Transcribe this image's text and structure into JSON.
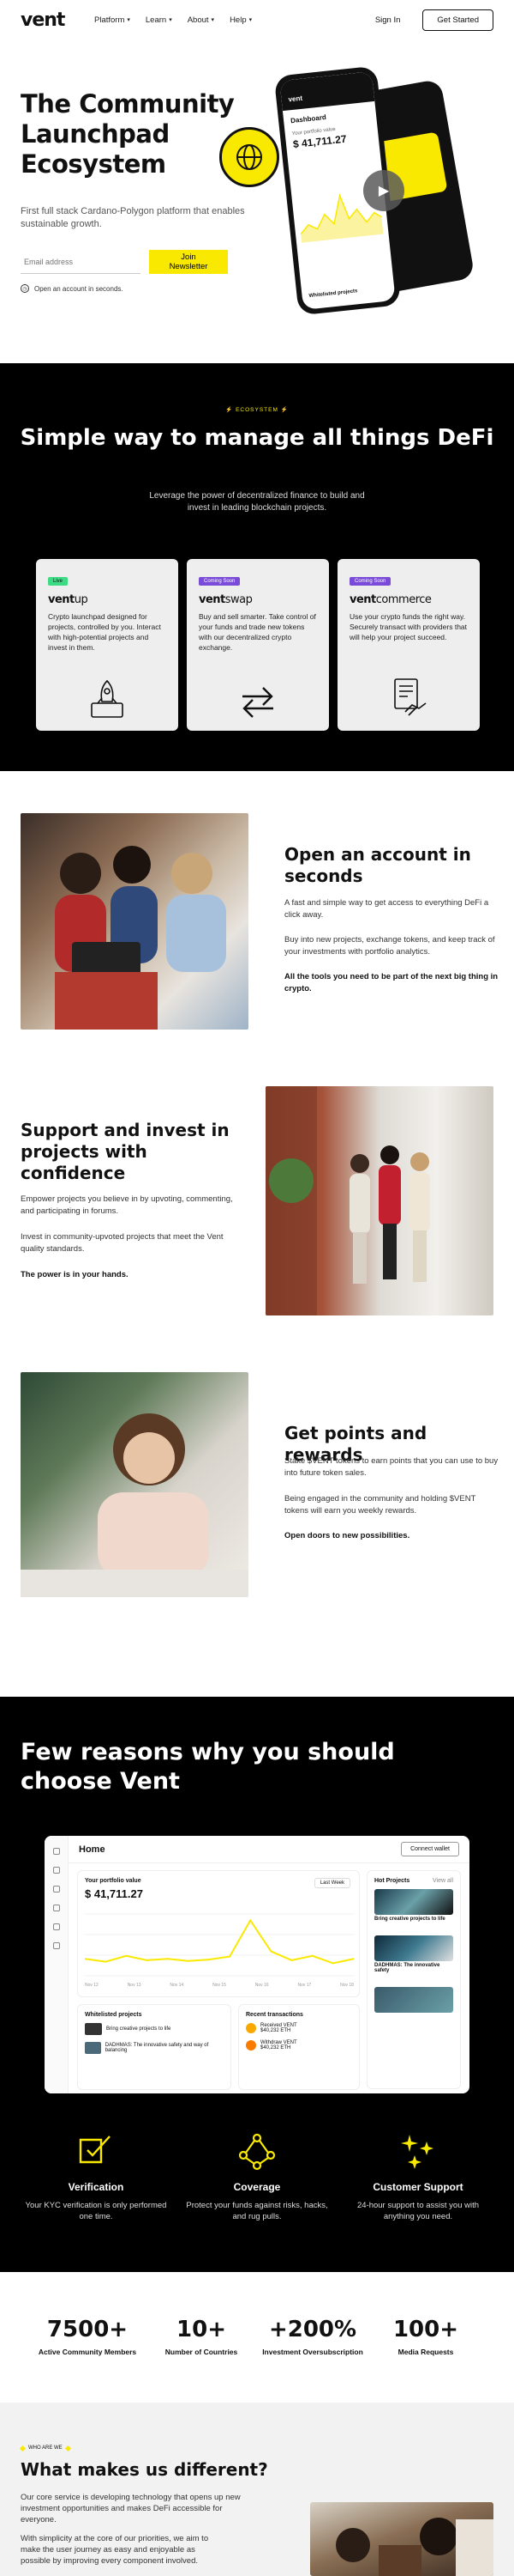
{
  "nav": {
    "logo": "vent",
    "links": [
      {
        "label": "Platform"
      },
      {
        "label": "Learn"
      },
      {
        "label": "About"
      },
      {
        "label": "Help"
      }
    ],
    "signin": "Sign In",
    "cta": "Get Started"
  },
  "hero": {
    "title": "The Community Launchpad Ecosystem",
    "subtitle": "First full stack Cardano-Polygon platform that enables sustainable growth.",
    "email_placeholder": "Email address",
    "button": "Join Newsletter",
    "note": "Open an account in seconds.",
    "phone": {
      "brand": "vent",
      "dashboard": "Dashboard",
      "portfolio_label": "Your portfolio value",
      "portfolio_value": "$ 41,711.27",
      "footer": "Whitelisted projects"
    }
  },
  "ecosystem": {
    "tag": "ECOSYSTEM",
    "title": "Simple way to manage all things DeFi",
    "subtitle": "Leverage the power of decentralized finance to build and invest in leading blockchain projects.",
    "cards": [
      {
        "badge": "Live",
        "brand_bold": "vent",
        "brand_light": "up",
        "desc": "Crypto launchpad designed for projects, controlled by you. Interact with high-potential projects and invest in them.",
        "icon": "rocket-icon"
      },
      {
        "badge": "Coming Soon",
        "brand_bold": "vent",
        "brand_light": "swap",
        "desc": "Buy and sell smarter. Take control of your funds and trade new tokens with our decentralized crypto exchange.",
        "icon": "swap-arrows-icon"
      },
      {
        "badge": "Coming Soon",
        "brand_bold": "vent",
        "brand_light": "commerce",
        "desc": "Use your crypto funds the right way. Securely transact with providers that will help your project succeed.",
        "icon": "contract-handshake-icon"
      }
    ]
  },
  "features": [
    {
      "title": "Open an account in seconds",
      "p1": "A fast and simple way to get access to everything DeFi a click away.",
      "p2": "Buy into new projects, exchange tokens, and keep track of your investments with portfolio analytics.",
      "bold": "All the tools you need to be part of the next big thing in crypto."
    },
    {
      "title": "Support and invest in projects with confidence",
      "p1": "Empower projects you believe in by upvoting, commenting, and participating in forums.",
      "p2": "Invest in community-upvoted projects that meet the Vent quality standards.",
      "bold": "The power is in your hands."
    },
    {
      "title": "Get points and rewards",
      "p1": "Stake $VENT tokens to earn points that you can use to buy into future token sales.",
      "p2": "Being engaged in the community and holding $VENT tokens will earn you weekly rewards.",
      "bold": "Open doors to new possibilities."
    }
  ],
  "reasons": {
    "title": "Few reasons why you should choose Vent",
    "dashboard": {
      "home": "Home",
      "connect": "Connect wallet",
      "portfolio_label": "Your portfolio value",
      "portfolio_value": "$ 41,711.27",
      "range": "Last Week",
      "x_ticks": [
        "Nov 12",
        "Nov 13",
        "Nov 14",
        "Nov 15",
        "Nov 16",
        "Nov 17",
        "Nov 18"
      ],
      "chart_values": [
        30,
        26,
        34,
        28,
        30,
        27,
        29,
        33,
        82,
        40,
        28,
        34,
        24,
        30
      ],
      "whitelisted_title": "Whitelisted projects",
      "whitelisted": [
        "Bring creative projects to life",
        "DADHMAS: The innovative safety and way of balancing"
      ],
      "transactions_title": "Recent transactions",
      "transactions": [
        {
          "name": "Received VENT",
          "amount": "$40,232 ETH"
        },
        {
          "name": "Withdraw VENT",
          "amount": "$40,232 ETH"
        }
      ],
      "hot_title": "Hot Projects",
      "hot_view": "View all",
      "hot": [
        "Bring creative projects to life",
        "DADHMAS: The innovative safety"
      ]
    },
    "items": [
      {
        "title": "Verification",
        "desc": "Your KYC verification is only performed one time.",
        "icon": "shield-check-icon"
      },
      {
        "title": "Coverage",
        "desc": "Protect your funds against risks, hacks, and rug pulls.",
        "icon": "network-nodes-icon"
      },
      {
        "title": "Customer Support",
        "desc": "24-hour support to assist you with anything you need.",
        "icon": "sparkles-icon"
      }
    ]
  },
  "stats": [
    {
      "num": "7500+",
      "label": "Active Community Members"
    },
    {
      "num": "10+",
      "label": "Number of Countries"
    },
    {
      "num": "+200%",
      "label": "Investment Oversubscription"
    },
    {
      "num": "100+",
      "label": "Media Requests"
    }
  ],
  "different": {
    "tag": "WHO ARE WE",
    "title": "What makes us different?",
    "p1": "Our core service is developing technology that opens up new investment opportunities and makes DeFi accessible for everyone.",
    "p2": "With simplicity at the core of our priorities, we aim to make the user journey as easy and enjoyable as possible by improving every component involved."
  },
  "colors": {
    "accent": "#f9e900",
    "dark": "#000000",
    "live": "#3ddc84",
    "soon": "#7a4bd8"
  }
}
